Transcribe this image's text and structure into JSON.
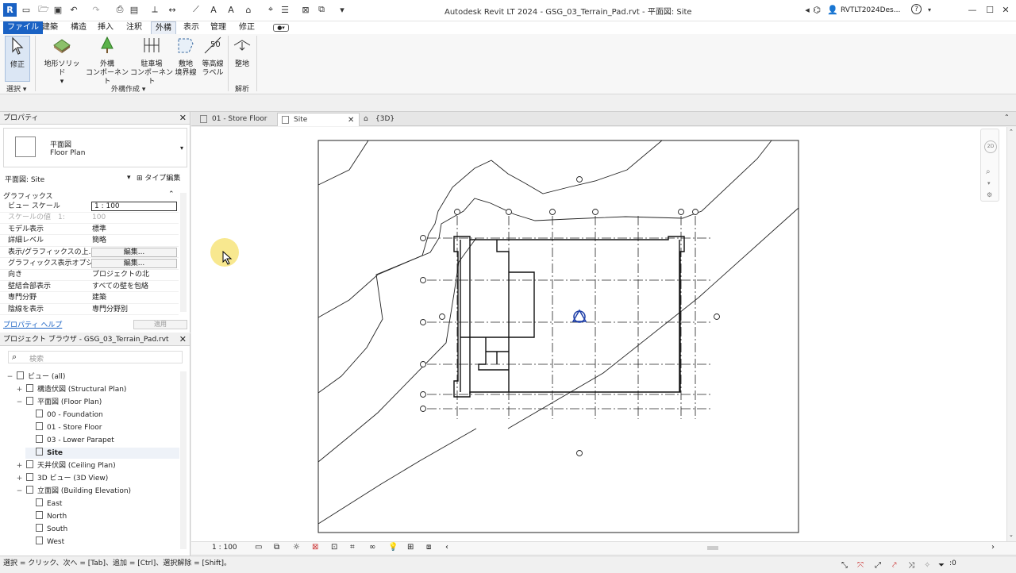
{
  "window": {
    "title": "Autodesk Revit LT 2024 - GSG_03_Terrain_Pad.rvt - 平面図: Site",
    "user": "RVTLT2024Des...",
    "help": "?"
  },
  "menu": {
    "tabs": [
      "ファイル",
      "建築",
      "構造",
      "挿入",
      "注釈",
      "外構",
      "表示",
      "管理",
      "修正"
    ],
    "active": "外構"
  },
  "ribbon": {
    "modify": "修正",
    "select_panel": "選択",
    "toposolid": "地形ソリッド",
    "site_component_1": "外構",
    "site_component_2": "コンポーネント",
    "parking_1": "駐車場",
    "parking_2": "コンポーネント",
    "property_line_1": "敷地",
    "property_line_2": "境界線",
    "contour_label_1": "等高線",
    "contour_label_2": "ラベル",
    "contour_num": "50",
    "graded_region": "整地",
    "create_panel": "外構作成",
    "analyze_panel": "解析"
  },
  "properties": {
    "header": "プロパティ",
    "type_name_1": "平面図",
    "type_name_2": "Floor Plan",
    "view_selector": "平面図: Site",
    "edit_type": "タイプ編集",
    "section": "グラフィックス",
    "rows": [
      {
        "k": "ビュー スケール",
        "v": "1 : 100"
      },
      {
        "k": "スケールの値　1:",
        "v": "100"
      },
      {
        "k": "モデル表示",
        "v": "標準"
      },
      {
        "k": "詳細レベル",
        "v": "簡略"
      },
      {
        "k": "表示/グラフィックスの上...",
        "v": "編集..."
      },
      {
        "k": "グラフィックス表示オプション",
        "v": "編集..."
      },
      {
        "k": "向き",
        "v": "プロジェクトの北"
      },
      {
        "k": "壁結合部表示",
        "v": "すべての壁を包絡"
      },
      {
        "k": "専門分野",
        "v": "建築"
      },
      {
        "k": "陰線を表示",
        "v": "専門分野別"
      }
    ],
    "help_link": "プロパティ ヘルプ",
    "apply": "適用"
  },
  "browser": {
    "header": "プロジェクト ブラウザ - GSG_03_Terrain_Pad.rvt",
    "search_placeholder": "検索",
    "nodes": [
      {
        "label": "ビュー (all)",
        "toggle": "−"
      },
      {
        "label": "構造伏図 (Structural Plan)",
        "toggle": "+"
      },
      {
        "label": "平面図 (Floor Plan)",
        "toggle": "−"
      },
      {
        "label": "00 - Foundation",
        "toggle": ""
      },
      {
        "label": "01 - Store Floor",
        "toggle": ""
      },
      {
        "label": "03 - Lower Parapet",
        "toggle": ""
      },
      {
        "label": "Site",
        "toggle": ""
      },
      {
        "label": "天井伏図 (Ceiling Plan)",
        "toggle": "+"
      },
      {
        "label": "3D ビュー (3D View)",
        "toggle": "+"
      },
      {
        "label": "立面図 (Building Elevation)",
        "toggle": "−"
      },
      {
        "label": "East",
        "toggle": ""
      },
      {
        "label": "North",
        "toggle": ""
      },
      {
        "label": "South",
        "toggle": ""
      },
      {
        "label": "West",
        "toggle": ""
      }
    ]
  },
  "view_tabs": [
    {
      "label": "01 - Store Floor",
      "active": false
    },
    {
      "label": "Site",
      "active": true
    },
    {
      "label": "{3D}",
      "active": false
    }
  ],
  "view_bar": {
    "scale": "1 : 100"
  },
  "navcube": {
    "label": "2D"
  },
  "status": {
    "hint": "選択 = クリック、次へ = [Tab]、追加 = [Ctrl]、選択解除 = [Shift]。",
    "filter_count": ":0"
  },
  "colors": {
    "file_tab": "#1a62c4",
    "accent": "#1e3fa8",
    "cursor_highlight": "#f5e06a"
  }
}
